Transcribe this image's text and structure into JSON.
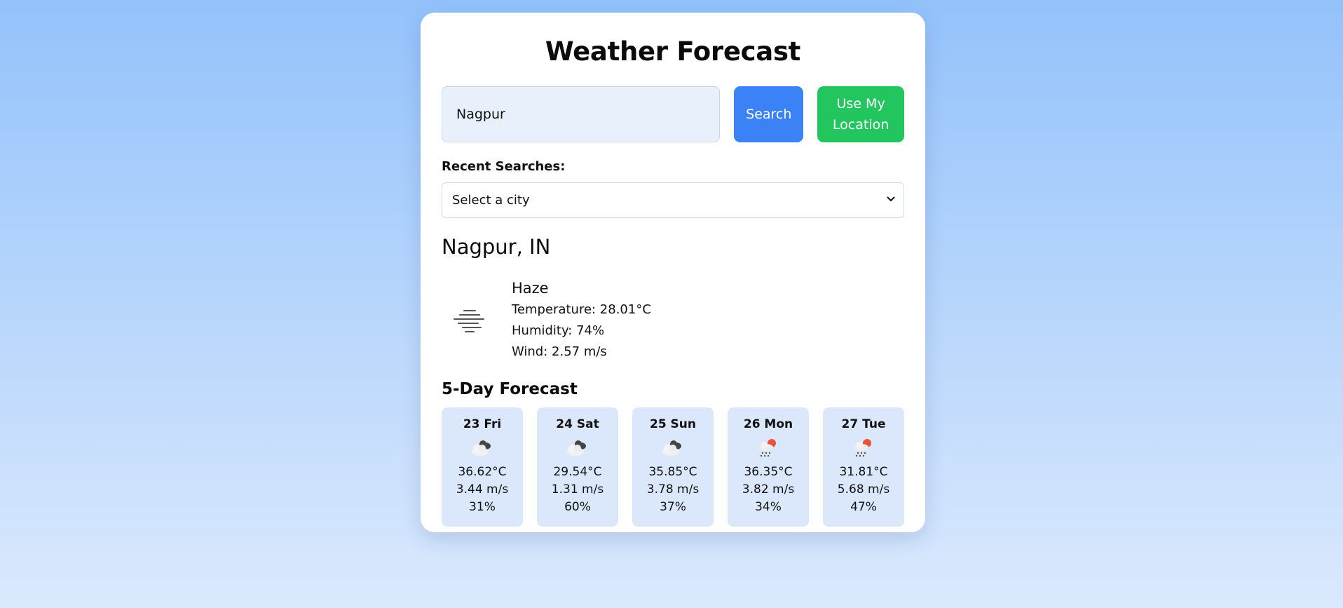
{
  "app": {
    "title": "Weather Forecast"
  },
  "search": {
    "value": "Nagpur",
    "search_label": "Search",
    "location_label": "Use My Location"
  },
  "recent": {
    "label": "Recent Searches:",
    "selected": "Select a city"
  },
  "current": {
    "location": "Nagpur, IN",
    "condition": "Haze",
    "icon": "haze-icon",
    "temperature": "Temperature: 28.01°C",
    "humidity": "Humidity: 74%",
    "wind": "Wind: 2.57 m/s"
  },
  "forecast": {
    "title": "5-Day Forecast",
    "days": [
      {
        "day": "23 Fri",
        "icon": "broken-clouds-icon",
        "temp": "36.62°C",
        "wind": "3.44 m/s",
        "humidity": "31%"
      },
      {
        "day": "24 Sat",
        "icon": "broken-clouds-icon",
        "temp": "29.54°C",
        "wind": "1.31 m/s",
        "humidity": "60%"
      },
      {
        "day": "25 Sun",
        "icon": "broken-clouds-icon",
        "temp": "35.85°C",
        "wind": "3.78 m/s",
        "humidity": "37%"
      },
      {
        "day": "26 Mon",
        "icon": "light-rain-sun-icon",
        "temp": "36.35°C",
        "wind": "3.82 m/s",
        "humidity": "34%"
      },
      {
        "day": "27 Tue",
        "icon": "light-rain-sun-icon",
        "temp": "31.81°C",
        "wind": "5.68 m/s",
        "humidity": "47%"
      }
    ]
  },
  "colors": {
    "search_button": "#3b82f6",
    "location_button": "#22c55e",
    "forecast_card": "#dbe8fc",
    "input_background": "#e8f0fc"
  }
}
